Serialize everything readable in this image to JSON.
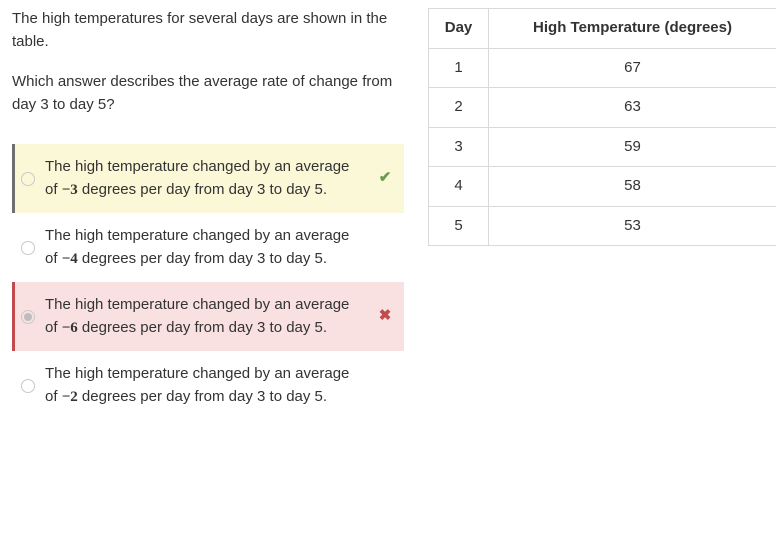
{
  "prompt": "The high temperatures for several days are shown in the table.",
  "question": "Which answer describes the average rate of change from day 3 to day 5?",
  "choices": [
    {
      "pre": "The high temperature changed by an average of ",
      "num": "−3",
      "post": " degrees per day from day 3 to day 5.",
      "status": "correct",
      "selected": false
    },
    {
      "pre": "The high temperature changed by an average of ",
      "num": "−4",
      "post": " degrees per day from day 3 to day 5.",
      "status": "normal",
      "selected": false
    },
    {
      "pre": "The high temperature changed by an average of ",
      "num": "−6",
      "post": " degrees per day from day 3 to day 5.",
      "status": "selected-wrong",
      "selected": true
    },
    {
      "pre": "The high temperature changed by an average of ",
      "num": "−2",
      "post": " degrees per day from day 3 to day 5.",
      "status": "normal",
      "selected": false
    }
  ],
  "marks": {
    "check": "✔",
    "cross": "✖"
  },
  "table": {
    "headers": {
      "day": "Day",
      "temp": "High Temperature (degrees)"
    },
    "rows": [
      {
        "day": "1",
        "temp": "67"
      },
      {
        "day": "2",
        "temp": "63"
      },
      {
        "day": "3",
        "temp": "59"
      },
      {
        "day": "4",
        "temp": "58"
      },
      {
        "day": "5",
        "temp": "53"
      }
    ]
  },
  "chart_data": {
    "type": "table",
    "columns": [
      "Day",
      "High Temperature (degrees)"
    ],
    "rows": [
      [
        1,
        67
      ],
      [
        2,
        63
      ],
      [
        3,
        59
      ],
      [
        4,
        58
      ],
      [
        5,
        53
      ]
    ]
  }
}
